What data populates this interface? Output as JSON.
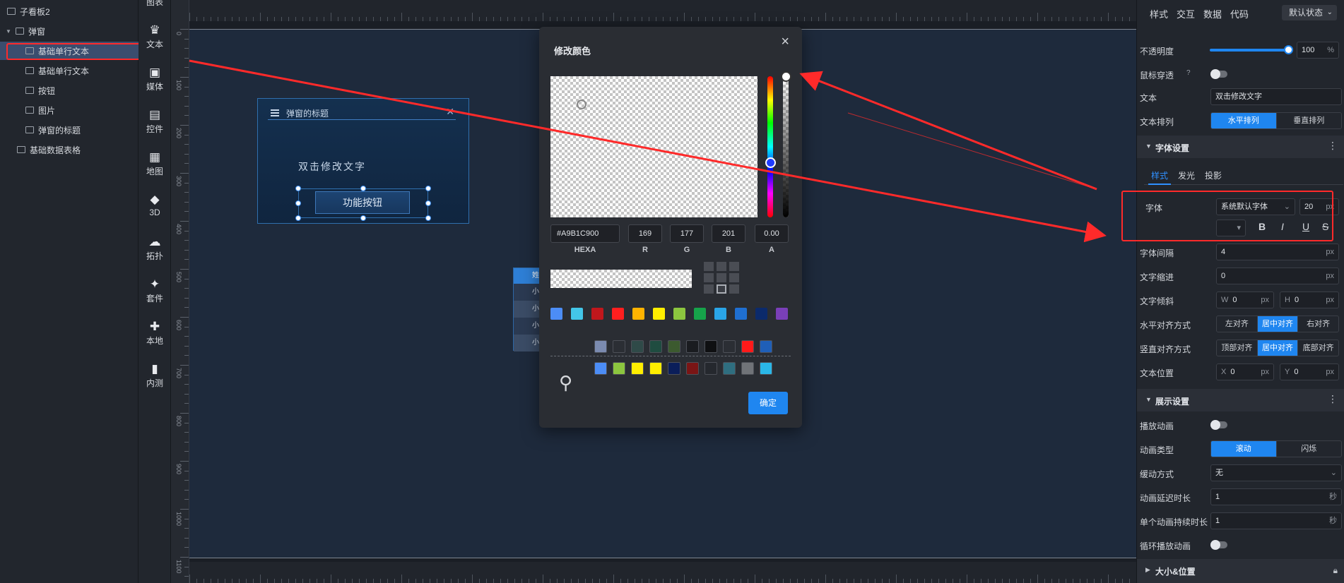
{
  "tree": {
    "root": "子看板2",
    "group": "弹窗",
    "items": [
      "基础单行文本",
      "基础单行文本",
      "按钮",
      "图片",
      "弹窗的标题"
    ],
    "table_item": "基础数据表格"
  },
  "rail": {
    "items": [
      {
        "label": "图表",
        "icon": "chart-icon"
      },
      {
        "label": "文本",
        "icon": "crown-text-icon"
      },
      {
        "label": "媒体",
        "icon": "media-icon"
      },
      {
        "label": "控件",
        "icon": "widget-icon"
      },
      {
        "label": "地图",
        "icon": "map-icon"
      },
      {
        "label": "3D",
        "icon": "cube-icon"
      },
      {
        "label": "拓扑",
        "icon": "topology-icon"
      },
      {
        "label": "套件",
        "icon": "kit-icon"
      },
      {
        "label": "本地",
        "icon": "puzzle-icon"
      },
      {
        "label": "内测",
        "icon": "bar-chart-icon"
      }
    ]
  },
  "ruler": {
    "labels": [
      "0",
      "100",
      "200",
      "300",
      "400",
      "500",
      "600",
      "700",
      "800",
      "900",
      "1000",
      "1100"
    ]
  },
  "canvas": {
    "dialog_title": "弹窗的标题",
    "dialog_text": "双击修改文字",
    "button_label": "功能按钮",
    "table_header": "姓",
    "table_rows": [
      "小",
      "小",
      "小",
      "小"
    ]
  },
  "picker": {
    "title": "修改颜色",
    "close": "×",
    "hexa": "#A9B1C900",
    "r": "169",
    "g": "177",
    "b": "201",
    "a": "0.00",
    "hexa_label": "HEXA",
    "r_label": "R",
    "g_label": "G",
    "b_label": "B",
    "a_label": "A",
    "preset_colors": [
      "#4c8df6",
      "#43c6e8",
      "#c0171c",
      "#ff1f1f",
      "#ffb300",
      "#ffee00",
      "#8cc63f",
      "#16a34a",
      "#2aa5e8",
      "#1f6fd1",
      "#0b2a6b",
      "#7a3fb8"
    ],
    "history_row1": [
      "#7b8bb0",
      "#2b2e34",
      "#2f4a48",
      "#1f4c40",
      "#3c5a2f",
      "#1a1c20",
      "#0f1012",
      "#2b2e34",
      "#ff1a1a",
      "#1f5fb8"
    ],
    "history_row2": [
      "#4c8df6",
      "#8cc63f",
      "#ffee00",
      "#ffee00",
      "#0b1e5a",
      "#7a1515",
      "#25282e",
      "#2f6e80",
      "#707378",
      "#2ab7e8"
    ],
    "confirm": "确定"
  },
  "props": {
    "tabs": [
      "样式",
      "交互",
      "数据",
      "代码"
    ],
    "state": "默认状态",
    "opacity_label": "不透明度",
    "opacity_value": "100",
    "opacity_unit": "%",
    "mouse_through_label": "鼠标穿透",
    "text_label": "文本",
    "text_value": "双击修改文字",
    "text_arrange_label": "文本排列",
    "arrange_options": [
      "水平排列",
      "垂直排列"
    ],
    "font_section": "字体设置",
    "font_subtabs": [
      "样式",
      "发光",
      "投影"
    ],
    "font_label": "字体",
    "font_family": "系统默认字体",
    "font_size": "20",
    "px": "px",
    "letter_spacing_label": "字体间隔",
    "letter_spacing": "4",
    "indent_label": "文字缩进",
    "indent": "0",
    "skew_label": "文字倾斜",
    "skew_w_label": "W",
    "skew_w": "0",
    "skew_h_label": "H",
    "skew_h": "0",
    "halign_label": "水平对齐方式",
    "halign_options": [
      "左对齐",
      "居中对齐",
      "右对齐"
    ],
    "valign_label": "竖直对齐方式",
    "valign_options": [
      "顶部对齐",
      "居中对齐",
      "底部对齐"
    ],
    "textpos_label": "文本位置",
    "x_label": "X",
    "x_value": "0",
    "y_label": "Y",
    "y_value": "0",
    "display_section": "展示设置",
    "play_anim_label": "播放动画",
    "anim_type_label": "动画类型",
    "anim_type_options": [
      "滚动",
      "闪烁"
    ],
    "easing_label": "缓动方式",
    "easing_value": "无",
    "delay_label": "动画延迟时长",
    "delay_value": "1",
    "duration_label": "单个动画持续时长",
    "duration_value": "1",
    "sec": "秒",
    "loop_label": "循环播放动画",
    "size_section": "大小&位置",
    "fmt": [
      "B",
      "I",
      "U",
      "S"
    ]
  }
}
